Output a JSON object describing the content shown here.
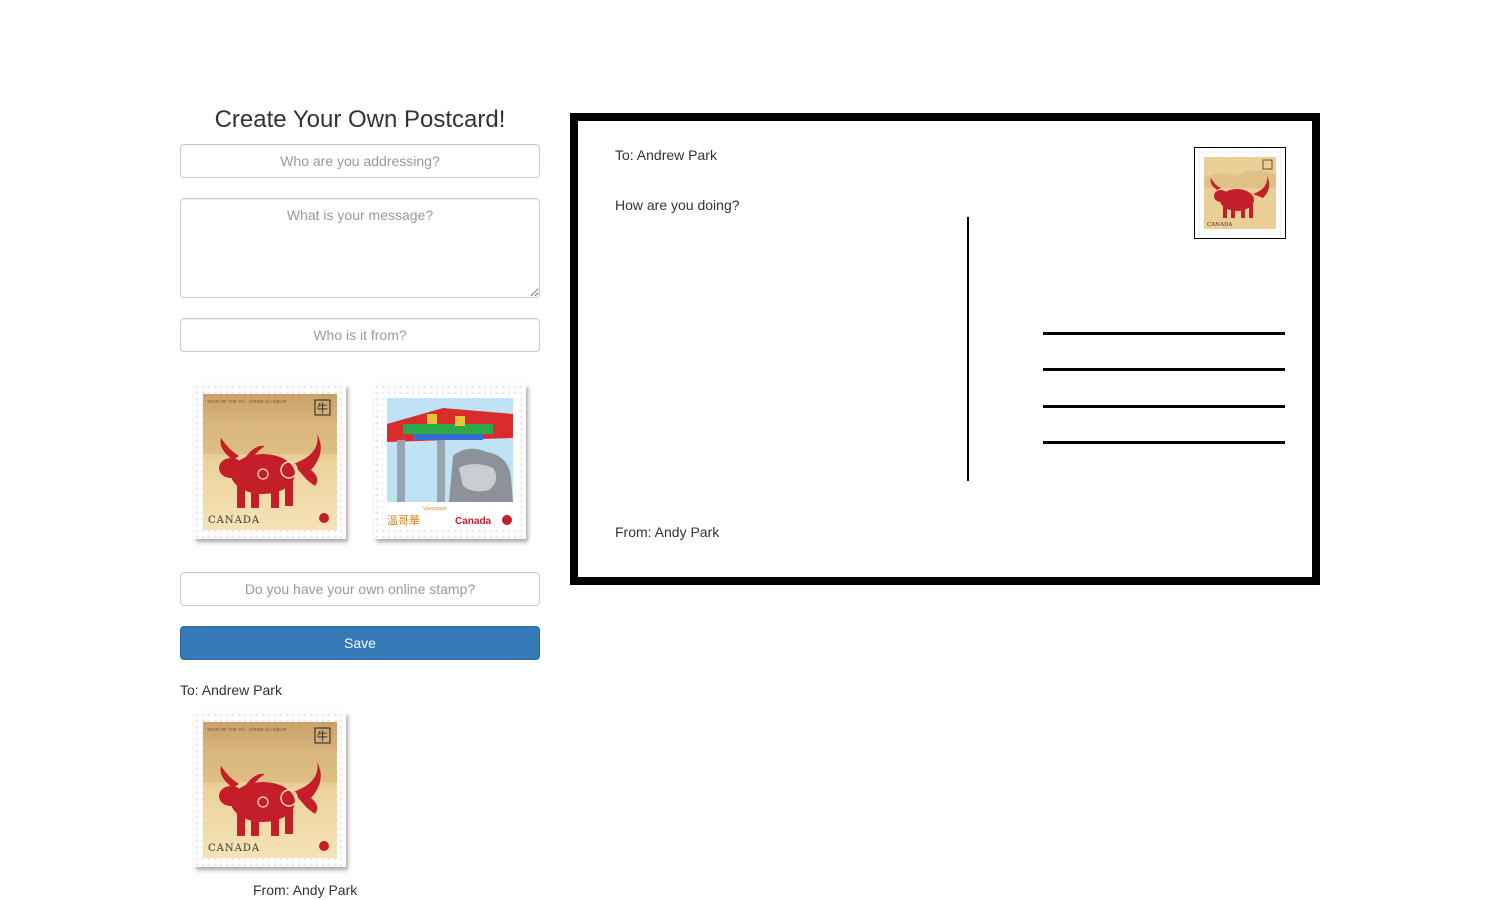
{
  "form": {
    "title": "Create Your Own Postcard!",
    "to_placeholder": "Who are you addressing?",
    "message_placeholder": "What is your message?",
    "from_placeholder": "Who is it from?",
    "stamp_url_placeholder": "Do you have your own online stamp?",
    "save_label": "Save"
  },
  "stamps": [
    {
      "name": "year-of-the-ox",
      "country": "CANADA",
      "header": "YEAR OF THE OX · ANNÉE DU BŒUF",
      "glyph": "牛"
    },
    {
      "name": "vancouver-chinatown",
      "country": "Canada",
      "city": "Vancouver",
      "chinese": "溫哥華"
    }
  ],
  "preview": {
    "to": "To: Andrew Park",
    "from": "From: Andy Park"
  },
  "postcard": {
    "to": "To: Andrew Park",
    "message": "How are you doing?",
    "from": "From: Andy Park"
  },
  "colors": {
    "primary": "#337ab7",
    "ox_red": "#c41e2a",
    "stamp_gold": "#e8c98a"
  }
}
